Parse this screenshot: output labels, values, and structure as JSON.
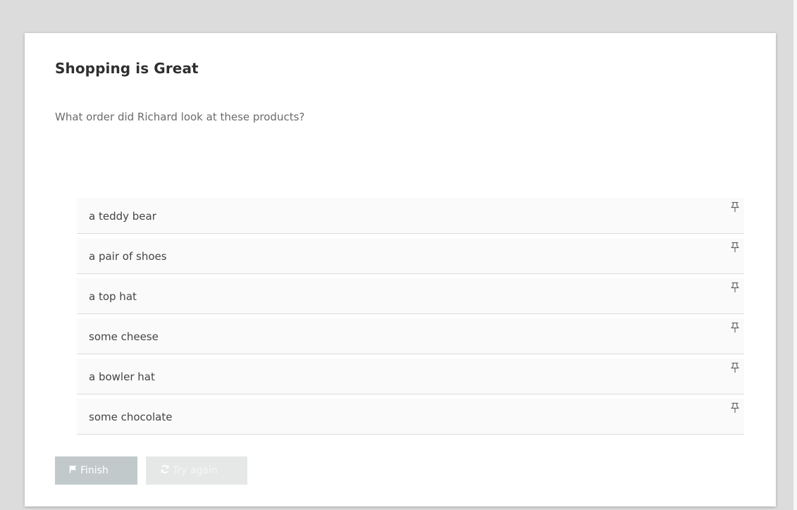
{
  "task": {
    "title": "Shopping is Great",
    "question": "What order did Richard look at these products?"
  },
  "items": [
    {
      "label": "a teddy bear"
    },
    {
      "label": "a pair of shoes"
    },
    {
      "label": "a top hat"
    },
    {
      "label": "some cheese"
    },
    {
      "label": "a bowler hat"
    },
    {
      "label": "some chocolate"
    }
  ],
  "buttons": {
    "finish_label": "Finish",
    "finish_icon": "flag-icon",
    "retry_label": "Try again",
    "retry_icon": "refresh-icon"
  },
  "icons": {
    "drag_handle": "pushpin-icon"
  },
  "colors": {
    "page_background": "#dcdcdc",
    "card_background": "#ffffff",
    "item_background": "#fafafa",
    "finish_button": "#c1c9cb",
    "retry_button": "#e6e8e8"
  }
}
